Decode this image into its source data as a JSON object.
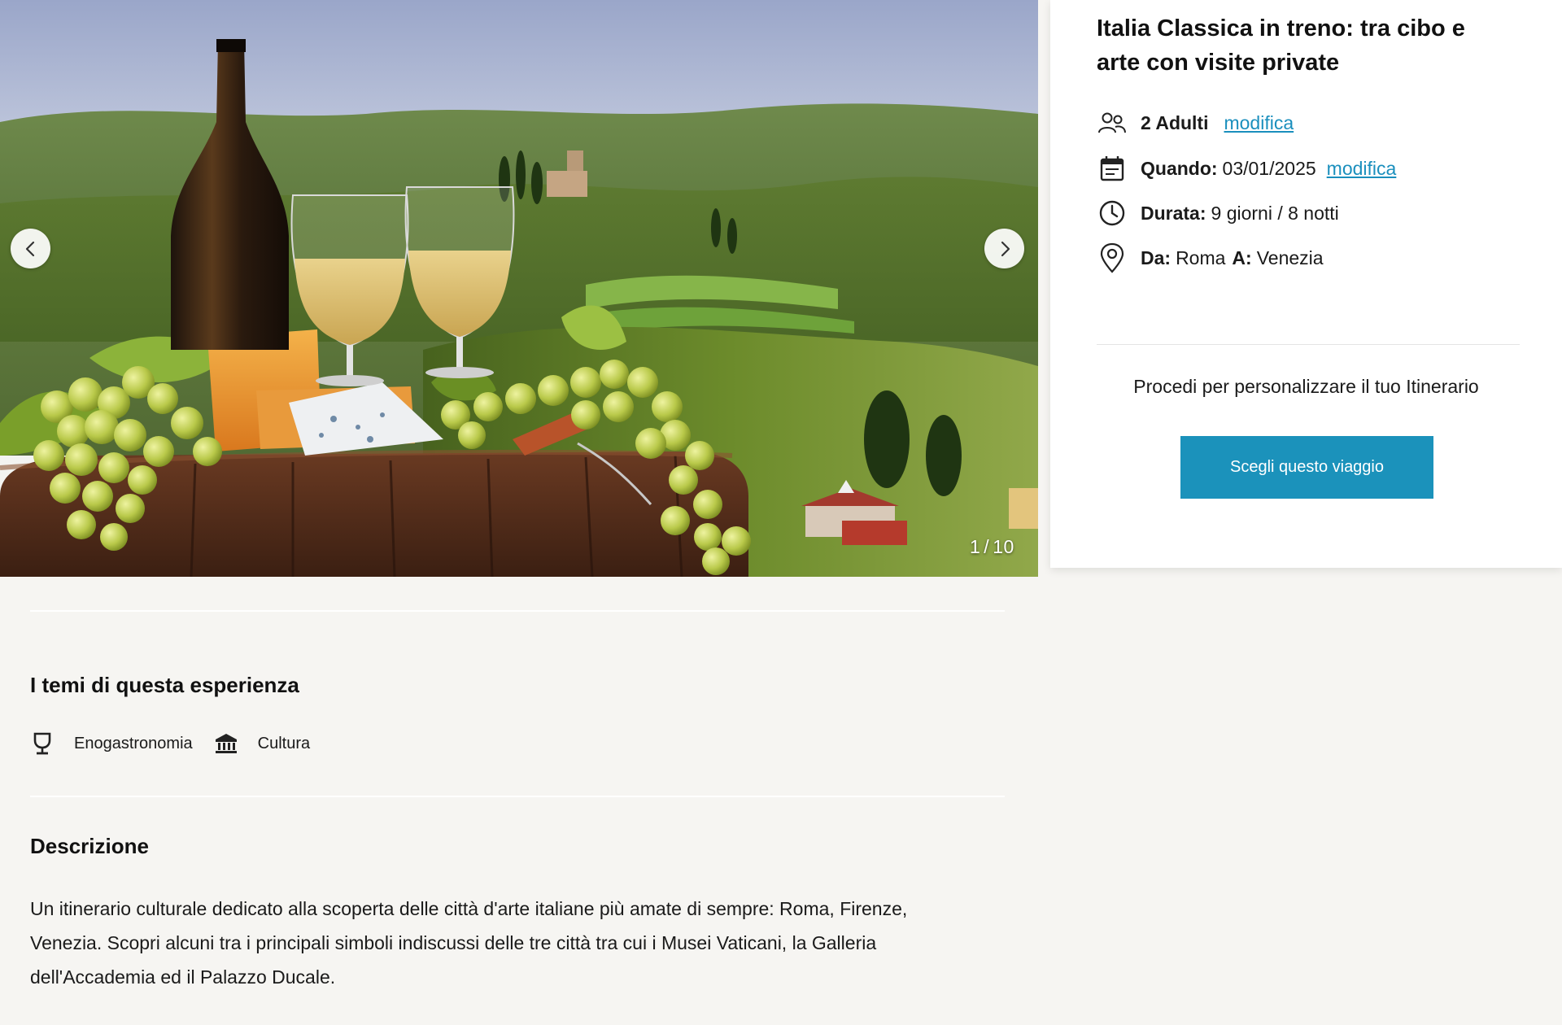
{
  "gallery": {
    "current": "1",
    "total": "10",
    "separator": "/",
    "prev_icon": "chevron-left-icon",
    "next_icon": "chevron-right-icon"
  },
  "panel": {
    "title": "Italia Classica in treno: tra cibo e arte con visite private",
    "adults": {
      "icon": "people-icon",
      "label": "2 Adulti",
      "link": "modifica"
    },
    "when": {
      "icon": "calendar-icon",
      "label": "Quando:",
      "value": "03/01/2025",
      "link": "modifica"
    },
    "duration": {
      "icon": "clock-icon",
      "label": "Durata:",
      "value": "9 giorni / 8 notti"
    },
    "route": {
      "icon": "location-pin-icon",
      "from_label": "Da:",
      "from_value": "Roma",
      "to_label": "A:",
      "to_value": "Venezia"
    },
    "proceed_text": "Procedi per personalizzare il tuo Itinerario",
    "cta_label": "Scegli questo viaggio"
  },
  "themes": {
    "title": "I temi di questa esperienza",
    "items": [
      {
        "icon": "trophy-icon",
        "label": "Enogastronomia"
      },
      {
        "icon": "museum-icon",
        "label": "Cultura"
      }
    ]
  },
  "description": {
    "title": "Descrizione",
    "text": "Un itinerario culturale dedicato alla scoperta delle città d'arte italiane più amate di sempre: Roma, Firenze, Venezia. Scopri alcuni tra i principali simboli indiscussi delle tre città tra cui i Musei Vaticani, la Galleria dell'Accademia ed il Palazzo Ducale."
  },
  "colors": {
    "accent": "#1b92bb",
    "link": "#1a8fbd",
    "page_bg": "#f6f5f2"
  }
}
